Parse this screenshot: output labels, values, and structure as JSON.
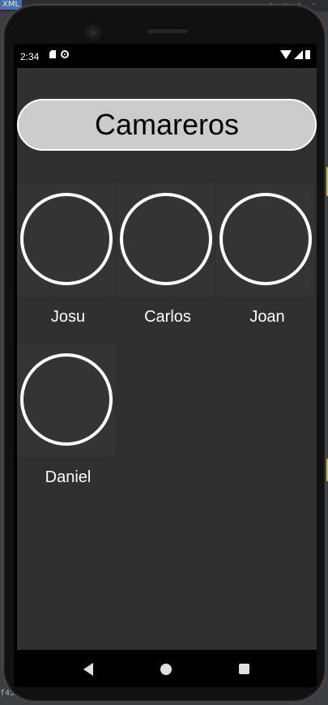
{
  "ide": {
    "file_tab": "XML",
    "code_fragment": "f45"
  },
  "status_bar": {
    "time": "2:34",
    "left_icons": [
      "sd-card-icon",
      "sync-icon"
    ],
    "right_icons": [
      "wifi-icon",
      "signal-icon",
      "battery-icon"
    ]
  },
  "app": {
    "title": "Camareros",
    "waiters": [
      {
        "name": "Josu"
      },
      {
        "name": "Carlos"
      },
      {
        "name": "Joan"
      },
      {
        "name": "Daniel"
      }
    ]
  },
  "nav_bar": {
    "icons": [
      "back-icon",
      "home-icon",
      "recents-icon"
    ]
  },
  "colors": {
    "app_background": "#303030",
    "title_background": "#cccccc",
    "title_border": "#ffffff",
    "avatar_ring": "#ffffff",
    "text_light": "#ffffff"
  }
}
